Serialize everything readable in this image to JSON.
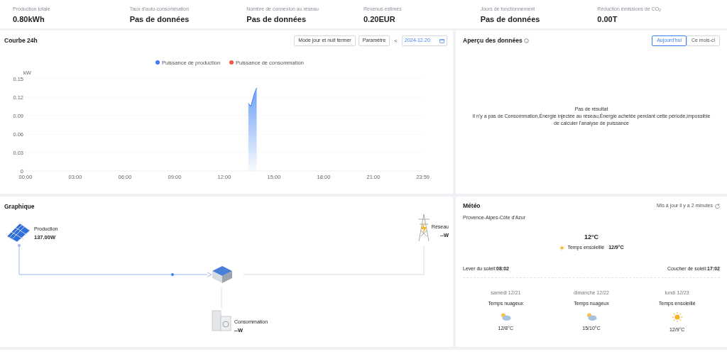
{
  "stats": [
    {
      "label": "Production totale",
      "value": "0.80kWh"
    },
    {
      "label": "Taux d'auto-consommation",
      "value": "Pas de données"
    },
    {
      "label": "Nombre de connexion au réseau",
      "value": "Pas de données"
    },
    {
      "label": "Revenus estimés",
      "value": "0.20EUR"
    },
    {
      "label": "Jours de fonctionnement",
      "value": "Pas de données"
    },
    {
      "label": "Réduction émissions de CO$_{2}$",
      "value": "0.00T"
    }
  ],
  "curve": {
    "title": "Courbe 24h",
    "buttons": [
      "Mode jour et nuit fermer",
      "Paramètre"
    ],
    "prev": "<",
    "date": "2024-12-20",
    "chart_data": {
      "type": "area",
      "grid": true,
      "ylabel": "kW",
      "x": [
        13.45,
        13.6,
        13.8,
        13.95
      ],
      "xlim": [
        0,
        24
      ],
      "ylim": [
        0,
        0.15
      ],
      "xticks": [
        {
          "value": 0,
          "label": "00:00"
        },
        {
          "value": 3,
          "label": "03:00"
        },
        {
          "value": 6,
          "label": "06:00"
        },
        {
          "value": 9,
          "label": "09:00"
        },
        {
          "value": 12,
          "label": "12:00"
        },
        {
          "value": 15,
          "label": "15:00"
        },
        {
          "value": 18,
          "label": "18:00"
        },
        {
          "value": 21,
          "label": "21:00"
        },
        {
          "value": 23.983,
          "label": "23:59"
        }
      ],
      "yticks": [
        {
          "value": 0,
          "label": "0"
        },
        {
          "value": 0.03,
          "label": "0.03"
        },
        {
          "value": 0.06,
          "label": "0.06"
        },
        {
          "value": 0.09,
          "label": "0.09"
        },
        {
          "value": 0.12,
          "label": "0.12"
        },
        {
          "value": 0.15,
          "label": "0.15"
        }
      ],
      "series": [
        {
          "name": "Puissance de production",
          "color": "#3b7ff5",
          "values": [
            0.11,
            0.105,
            0.125,
            0.135
          ]
        },
        {
          "name": "Puissance de consommation",
          "color": "#f05a4a",
          "values": [
            null,
            null,
            null,
            null
          ]
        }
      ]
    }
  },
  "overview": {
    "title": "Aperçu des données",
    "tabs": [
      {
        "label": "Aujourd'hui",
        "selected": true
      },
      {
        "label": "Ce mois-ci",
        "selected": false
      }
    ],
    "empty_title": "Pas de résultat",
    "empty_text": "Il n'y a pas de Consommation,Énergie injectée au réseau,Énergie achetée pendant cette période,impossible de calculer l'analyse de puissance"
  },
  "diagram": {
    "title": "Graphique",
    "production": {
      "label": "Production",
      "value": "137.00W"
    },
    "grid": {
      "label": "Réseau",
      "value": "--W"
    },
    "consumption": {
      "label": "Consommation",
      "value": "--W"
    }
  },
  "weather": {
    "title": "Météo",
    "updated": "Mis à jour il y a 2 minutes",
    "region": "Provence-Alpes-Côte d'Azur",
    "temp": "12°C",
    "condition": "Temps ensoleillé",
    "range": "12/9°C",
    "sunrise_label": "Lever du soleil:",
    "sunrise": "08:02",
    "sunset_label": "Coucher de soleil:",
    "sunset": "17:02",
    "forecast": [
      {
        "day": "samedi 12/21",
        "condition": "Temps nuageux",
        "kind": "cloudy",
        "range": "12/8°C"
      },
      {
        "day": "dimanche 12/22",
        "condition": "Temps nuageux",
        "kind": "cloudy",
        "range": "15/10°C"
      },
      {
        "day": "lundi 12/23",
        "condition": "Temps ensoleillé",
        "kind": "sunny",
        "range": "12/9°C"
      }
    ]
  }
}
